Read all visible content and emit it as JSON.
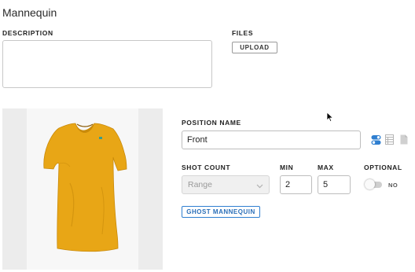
{
  "page": {
    "title": "Mannequin"
  },
  "description": {
    "label": "DESCRIPTION",
    "value": ""
  },
  "files": {
    "label": "FILES",
    "upload_label": "UPLOAD"
  },
  "position": {
    "label": "POSITION NAME",
    "value": "Front",
    "icons": [
      "toggle-settings-icon",
      "table-icon",
      "document-icon"
    ]
  },
  "shot_count": {
    "label": "SHOT COUNT",
    "selected": "Range"
  },
  "min": {
    "label": "MIN",
    "value": "2"
  },
  "max": {
    "label": "MAX",
    "value": "5"
  },
  "optional": {
    "label": "OPTIONAL",
    "state": "NO",
    "on": false
  },
  "ghost_button": {
    "label": "GHOST MANNEQUIN"
  },
  "colors": {
    "accent": "#2f7fd0",
    "shirt": "#e8a616",
    "panel_bg": "#ececec"
  }
}
